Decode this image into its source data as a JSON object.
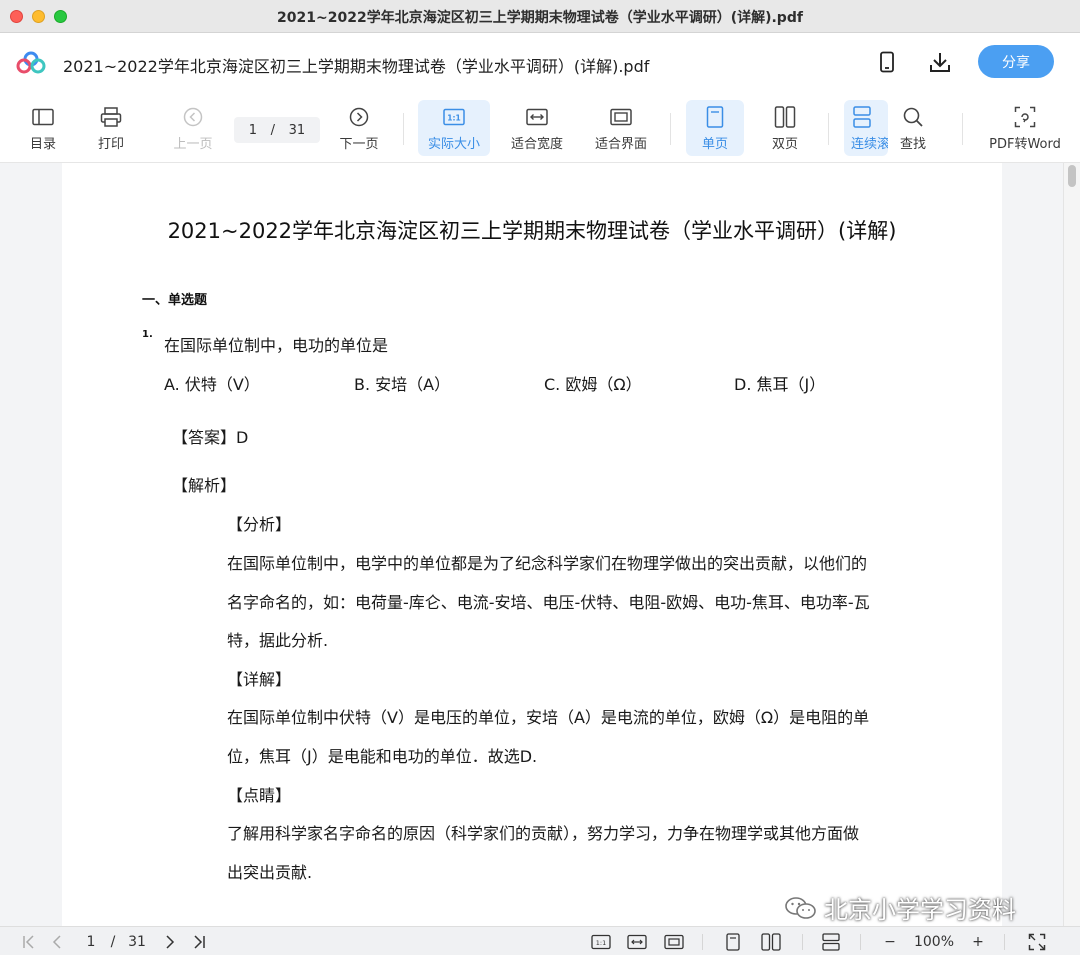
{
  "window": {
    "title": "2021~2022学年北京海淀区初三上学期期末物理试卷（学业水平调研）(详解).pdf"
  },
  "header": {
    "doc_title": "2021~2022学年北京海淀区初三上学期期末物理试卷（学业水平调研）(详解).pdf",
    "share_label": "分享",
    "icons": [
      "phone-icon",
      "download-icon"
    ]
  },
  "toolbar": {
    "toc": "目录",
    "print": "打印",
    "prev": "上一页",
    "page_current": "1",
    "page_sep": "/",
    "page_total": "31",
    "next": "下一页",
    "actual_size": "实际大小",
    "fit_width": "适合宽度",
    "fit_page": "适合界面",
    "single": "单页",
    "double": "双页",
    "continuous": "连续滚",
    "search": "查找",
    "pdf_to_word": "PDF转Word"
  },
  "document": {
    "title": "2021~2022学年北京海淀区初三上学期期末物理试卷（学业水平调研）(详解)",
    "section": "一、单选题",
    "question_number": "1.",
    "question": "在国际单位制中，电功的单位是",
    "options": [
      "A. 伏特（V）",
      "B. 安培（A）",
      "C. 欧姆（Ω）",
      "D. 焦耳（J）"
    ],
    "answer": "【答案】D",
    "analysis_heading": "【解析】",
    "lines": [
      "【分析】",
      "在国际单位制中，电学中的单位都是为了纪念科学家们在物理学做出的突出贡献，以他们的",
      "名字命名的，如：电荷量-库仑、电流-安培、电压-伏特、电阻-欧姆、电功-焦耳、电功率-瓦",
      "特，据此分析.",
      "【详解】",
      "在国际单位制中伏特（V）是电压的单位，安培（A）是电流的单位，欧姆（Ω）是电阻的单",
      "位，焦耳（J）是电能和电功的单位．故选D.",
      "【点睛】",
      "了解用科学家名字命名的原因（科学家们的贡献），努力学习，力争在物理学或其他方面做",
      "出突出贡献."
    ],
    "watermark": "北京小学学习资料"
  },
  "bottombar": {
    "page_current": "1",
    "page_sep": "/",
    "page_total": "31",
    "zoom": "100%",
    "zoom_out": "−",
    "zoom_in": "+"
  }
}
